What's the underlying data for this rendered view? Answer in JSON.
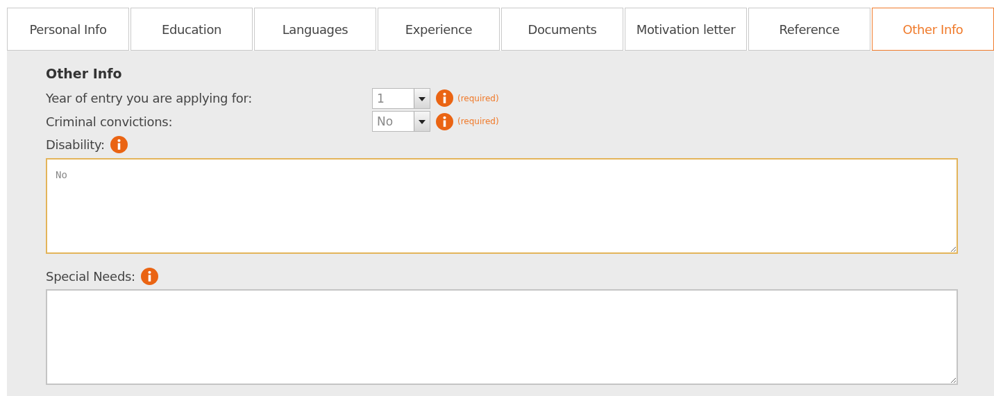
{
  "tabs": [
    {
      "label": "Personal Info",
      "selected": false
    },
    {
      "label": "Education",
      "selected": false
    },
    {
      "label": "Languages",
      "selected": false
    },
    {
      "label": "Experience",
      "selected": false
    },
    {
      "label": "Documents",
      "selected": false
    },
    {
      "label": "Motivation letter",
      "selected": false
    },
    {
      "label": "Reference",
      "selected": false
    },
    {
      "label": "Other Info",
      "selected": true
    }
  ],
  "form": {
    "heading": "Other Info",
    "selects": [
      {
        "label": "Year of entry you are applying for:",
        "value": "1",
        "note": "(required)"
      },
      {
        "label": "Criminal convictions:",
        "value": "No",
        "note": "(required)"
      }
    ],
    "text_areas": [
      {
        "label": "Disability:",
        "placeholder": "No",
        "focused": true
      },
      {
        "label": "Special Needs:",
        "focused": false
      }
    ]
  }
}
